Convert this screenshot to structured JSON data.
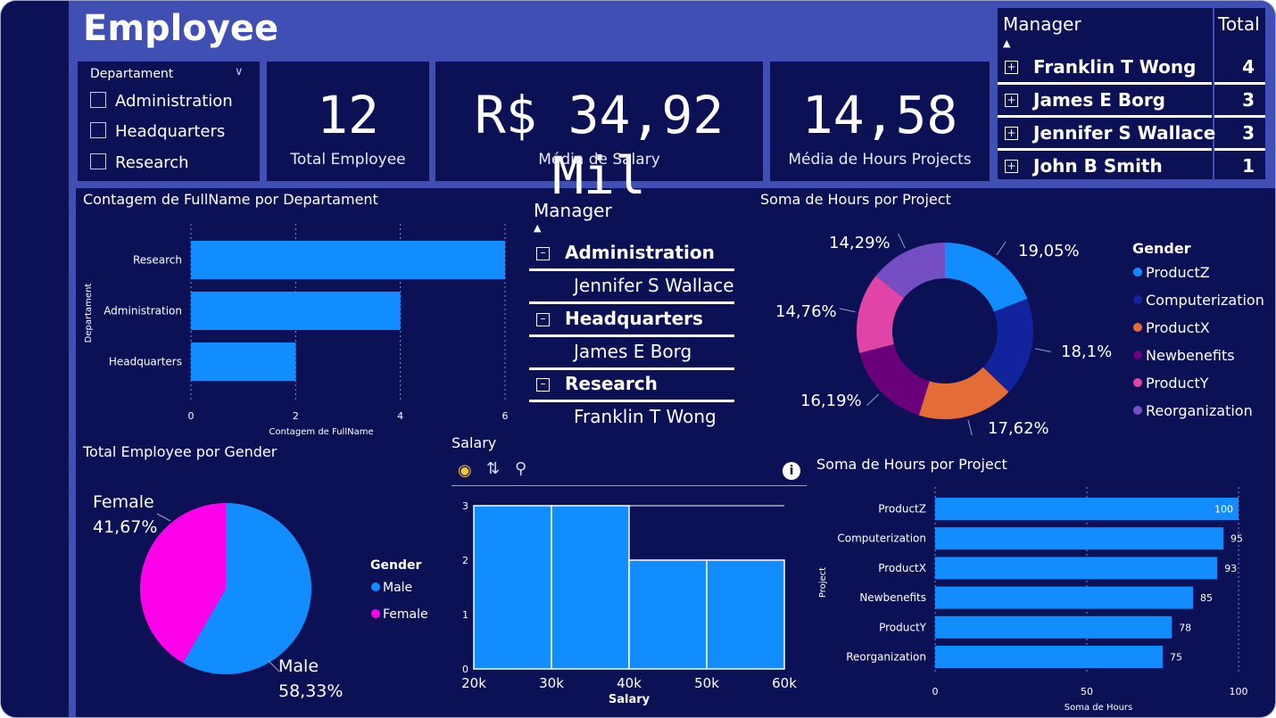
{
  "title": "Employee",
  "slicer": {
    "title": "Departament",
    "options": [
      "Administration",
      "Headquarters",
      "Research"
    ]
  },
  "kpis": [
    {
      "value": "12",
      "label": "Total Employee"
    },
    {
      "value": "R$ 34,92 Mil",
      "label": "Média de Salary"
    },
    {
      "value": "14,58",
      "label": "Média de Hours Projects"
    }
  ],
  "manager_table": {
    "col_manager": "Manager",
    "col_total": "Total",
    "rows": [
      {
        "name": "Franklin T Wong",
        "total": "4"
      },
      {
        "name": "James E Borg",
        "total": "3"
      },
      {
        "name": "Jennifer S Wallace",
        "total": "3"
      },
      {
        "name": "John B Smith",
        "total": "1"
      }
    ]
  },
  "matrix": {
    "header": "Manager",
    "groups": [
      {
        "department": "Administration",
        "manager": "Jennifer S Wallace"
      },
      {
        "department": "Headquarters",
        "manager": "James E Borg"
      },
      {
        "department": "Research",
        "manager": "Franklin T Wong"
      }
    ]
  },
  "colors": {
    "bar": "#118dff",
    "background": "#0b1154",
    "header": "#3f4fb3",
    "male": "#118dff",
    "female": "#ff00ea"
  },
  "chart_data": [
    {
      "type": "bar",
      "orientation": "horizontal",
      "title": "Contagem de FullName por Departament",
      "xlabel": "Contagem de FullName",
      "ylabel": "Departament",
      "categories": [
        "Research",
        "Administration",
        "Headquarters"
      ],
      "values": [
        6,
        4,
        2
      ],
      "xticks": [
        "0",
        "2",
        "4",
        "6"
      ],
      "xlim": [
        0,
        6
      ],
      "grid": true
    },
    {
      "type": "pie",
      "variant": "donut",
      "title": "Soma de Hours por Project",
      "legend_title": "Gender",
      "legend_position": "right",
      "slices": [
        {
          "name": "ProductZ",
          "value": 19.05,
          "label": "19,05%",
          "color": "#118dff"
        },
        {
          "name": "Computerization",
          "value": 18.1,
          "label": "18,1%",
          "color": "#12239e"
        },
        {
          "name": "ProductX",
          "value": 17.62,
          "label": "17,62%",
          "color": "#e66c37"
        },
        {
          "name": "Newbenefits",
          "value": 16.19,
          "label": "16,19%",
          "color": "#6b007b"
        },
        {
          "name": "ProductY",
          "value": 14.76,
          "label": "14,76%",
          "color": "#e044a7"
        },
        {
          "name": "Reorganization",
          "value": 14.29,
          "label": "14,29%",
          "color": "#744ec2"
        }
      ]
    },
    {
      "type": "pie",
      "title": "Total Employee por Gender",
      "legend_title": "Gender",
      "legend_position": "right",
      "slices": [
        {
          "name": "Male",
          "value": 58.33,
          "label": "58,33%",
          "color": "#118dff"
        },
        {
          "name": "Female",
          "value": 41.67,
          "label": "41,67%",
          "color": "#ff00ea"
        }
      ]
    },
    {
      "type": "bar",
      "variant": "histogram",
      "title": "Salary",
      "xlabel": "Salary",
      "bins": [
        {
          "from": 20,
          "to": 30,
          "count": 3
        },
        {
          "from": 30,
          "to": 40,
          "count": 3
        },
        {
          "from": 40,
          "to": 50,
          "count": 2
        },
        {
          "from": 50,
          "to": 60,
          "count": 2
        }
      ],
      "xticks": [
        "20k",
        "30k",
        "40k",
        "50k",
        "60k"
      ],
      "yticks": [
        "0",
        "1",
        "2",
        "3"
      ],
      "ylim": [
        0,
        3
      ]
    },
    {
      "type": "bar",
      "orientation": "horizontal",
      "title": "Soma de Hours por Project",
      "xlabel": "Soma de Hours",
      "ylabel": "Project",
      "categories": [
        "ProductZ",
        "Computerization",
        "ProductX",
        "Newbenefits",
        "ProductY",
        "Reorganization"
      ],
      "values": [
        100,
        95,
        93,
        85,
        78,
        75
      ],
      "xticks": [
        "0",
        "50",
        "100"
      ],
      "xlim": [
        0,
        100
      ],
      "grid": true
    }
  ]
}
